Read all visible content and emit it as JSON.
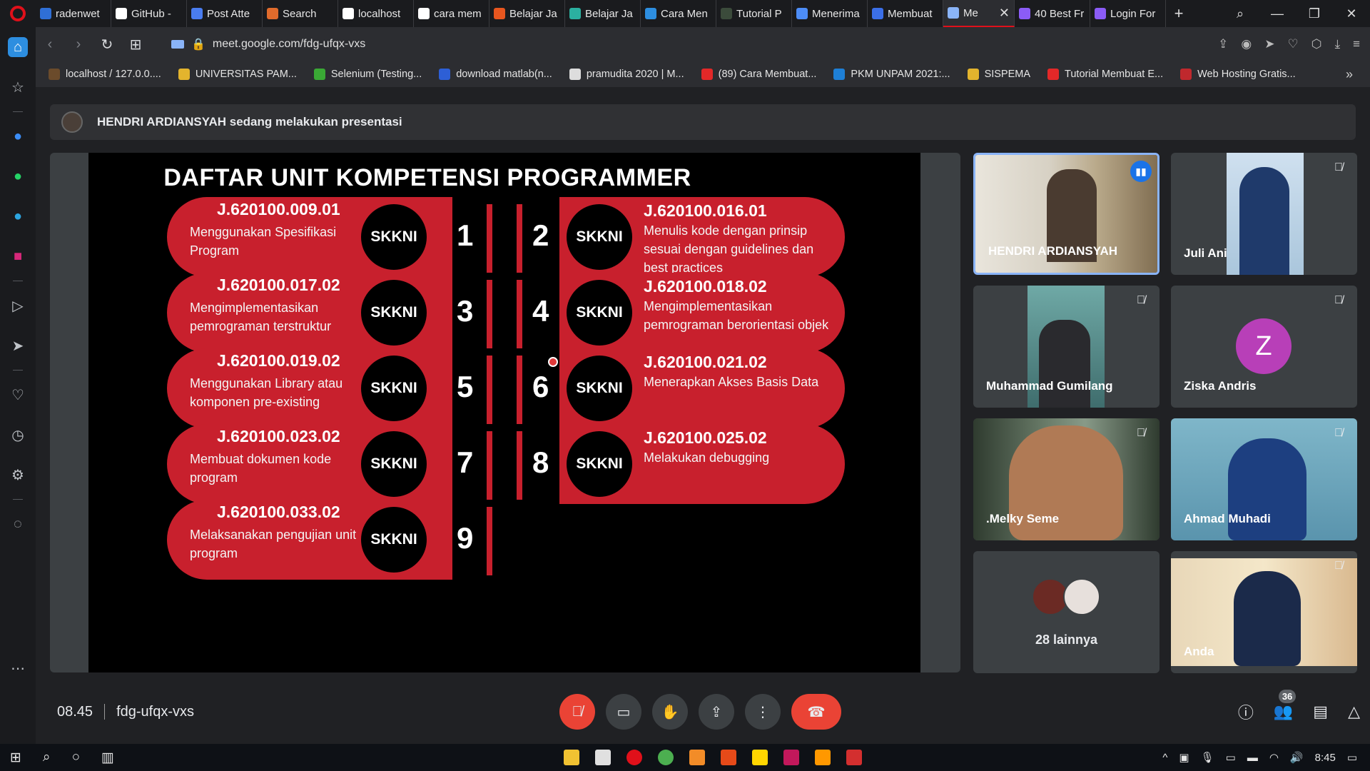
{
  "browser": {
    "tabs": [
      {
        "label": "radenwet",
        "color": "#2f6fd6"
      },
      {
        "label": "GitHub - ",
        "color": "#ffffff"
      },
      {
        "label": "Post Atte",
        "color": "#4a7df0"
      },
      {
        "label": "Search",
        "color": "#e06b2c"
      },
      {
        "label": "localhost",
        "color": "#ffffff"
      },
      {
        "label": "cara mem",
        "color": "#ffffff"
      },
      {
        "label": "Belajar Ja",
        "color": "#e8561f"
      },
      {
        "label": "Belajar Ja",
        "color": "#2bb0a0"
      },
      {
        "label": "Cara Men",
        "color": "#2d8ee0"
      },
      {
        "label": "Tutorial P",
        "color": "#3b4b3b"
      },
      {
        "label": "Menerima",
        "color": "#4d8df7"
      },
      {
        "label": "Membuat",
        "color": "#3b6fe8"
      },
      {
        "label": "Me",
        "color": "#8ab4f8"
      },
      {
        "label": "40 Best Fr",
        "color": "#8b5cf6"
      },
      {
        "label": "Login For",
        "color": "#8b5cf6"
      }
    ],
    "address": "meet.google.com/fdg-ufqx-vxs",
    "bookmarks": [
      {
        "label": "localhost / 127.0.0....",
        "color": "#6b4b2b"
      },
      {
        "label": "UNIVERSITAS PAM...",
        "color": "#e3b42d"
      },
      {
        "label": "Selenium (Testing...",
        "color": "#3aa935"
      },
      {
        "label": "download matlab(n...",
        "color": "#2d5fd6"
      },
      {
        "label": "pramudita 2020 | M...",
        "color": "#dddddd"
      },
      {
        "label": "(89) Cara Membuat...",
        "color": "#e32828"
      },
      {
        "label": "PKM UNPAM 2021:...",
        "color": "#1e7fd6"
      },
      {
        "label": "SISPEMA",
        "color": "#e3b42d"
      },
      {
        "label": "Tutorial Membuat E...",
        "color": "#e32828"
      },
      {
        "label": "Web Hosting Gratis...",
        "color": "#c0282d"
      }
    ]
  },
  "meet": {
    "presenting_text": "HENDRI ARDIANSYAH sedang melakukan presentasi",
    "time": "08.45",
    "meeting_code": "fdg-ufqx-vxs",
    "participant_count": "36",
    "more_label": "28 lainnya",
    "participants": [
      {
        "name": "HENDRI ARDIANSYAH"
      },
      {
        "name": "Juli Ani"
      },
      {
        "name": "Muhammad Gumilang"
      },
      {
        "name": "Ziska Andris",
        "initial": "Z"
      },
      {
        "name": ".Melky Seme"
      },
      {
        "name": "Ahmad Muhadi"
      },
      {
        "name": "Anda"
      }
    ]
  },
  "slide": {
    "title": "DAFTAR UNIT KOMPETENSI PROGRAMMER",
    "badge": "SKKNI",
    "units": [
      {
        "num": "1",
        "code": "J.620100.009.01",
        "desc": "Menggunakan Spesifikasi Program"
      },
      {
        "num": "2",
        "code": "J.620100.016.01",
        "desc": "Menulis kode dengan prinsip sesuai dengan guidelines dan best practices"
      },
      {
        "num": "3",
        "code": "J.620100.017.02",
        "desc": "Mengimplementasikan pemrograman terstruktur"
      },
      {
        "num": "4",
        "code": "J.620100.018.02",
        "desc": "Mengimplementasikan pemrograman berorientasi objek"
      },
      {
        "num": "5",
        "code": "J.620100.019.02",
        "desc": "Menggunakan Library atau komponen pre-existing"
      },
      {
        "num": "6",
        "code": "J.620100.021.02",
        "desc": "Menerapkan Akses Basis Data"
      },
      {
        "num": "7",
        "code": "J.620100.023.02",
        "desc": "Membuat dokumen kode program"
      },
      {
        "num": "8",
        "code": "J.620100.025.02",
        "desc": "Melakukan debugging"
      },
      {
        "num": "9",
        "code": "J.620100.033.02",
        "desc": "Melaksanakan pengujian unit program"
      }
    ]
  },
  "taskbar": {
    "clock": "8:45"
  }
}
